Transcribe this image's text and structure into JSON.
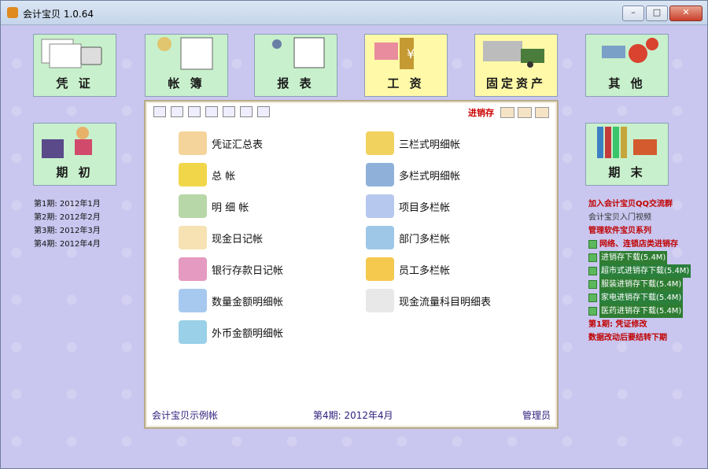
{
  "window": {
    "title": "会计宝贝 1.0.64",
    "min": "–",
    "max": "□",
    "close": "✕"
  },
  "tiles": [
    {
      "label": "凭  证"
    },
    {
      "label": "帐  簿"
    },
    {
      "label": "报  表"
    },
    {
      "label": "工  资"
    },
    {
      "label": "固定资产"
    },
    {
      "label": "其  他"
    },
    {
      "label": "期  初"
    },
    {
      "label": "期  末"
    }
  ],
  "periods": [
    "第1期: 2012年1月",
    "第2期: 2012年2月",
    "第3期: 2012年3月",
    "第4期: 2012年4月"
  ],
  "toolbar": {
    "jxc": "进销存"
  },
  "menu_left": [
    "凭证汇总表",
    "总    帐",
    "明  细  帐",
    "现金日记帐",
    "银行存款日记帐",
    "数量金额明细帐",
    "外币金额明细帐"
  ],
  "menu_right": [
    "三栏式明细帐",
    "多栏式明细帐",
    "项目多栏帐",
    "部门多栏帐",
    "员工多栏帐",
    "现金流量科目明细表"
  ],
  "footer": {
    "account": "会计宝贝示例帐",
    "period": "第4期: 2012年4月",
    "user": "管理员"
  },
  "right_info": {
    "qq": "加入会计宝贝QQ交流群",
    "video": "会计宝贝入门视频",
    "series": "管理软件宝贝系列",
    "chain": "网络、连锁店类进销存",
    "downloads": [
      "进销存下载(5.4M)",
      "超市式进销存下载(5.4M)",
      "服装进销存下载(5.4M)",
      "家电进销存下载(5.4M)",
      "医药进销存下载(5.4M)"
    ],
    "note1": "第1期: 凭证修改",
    "note2": "数据改动后要结转下期"
  }
}
